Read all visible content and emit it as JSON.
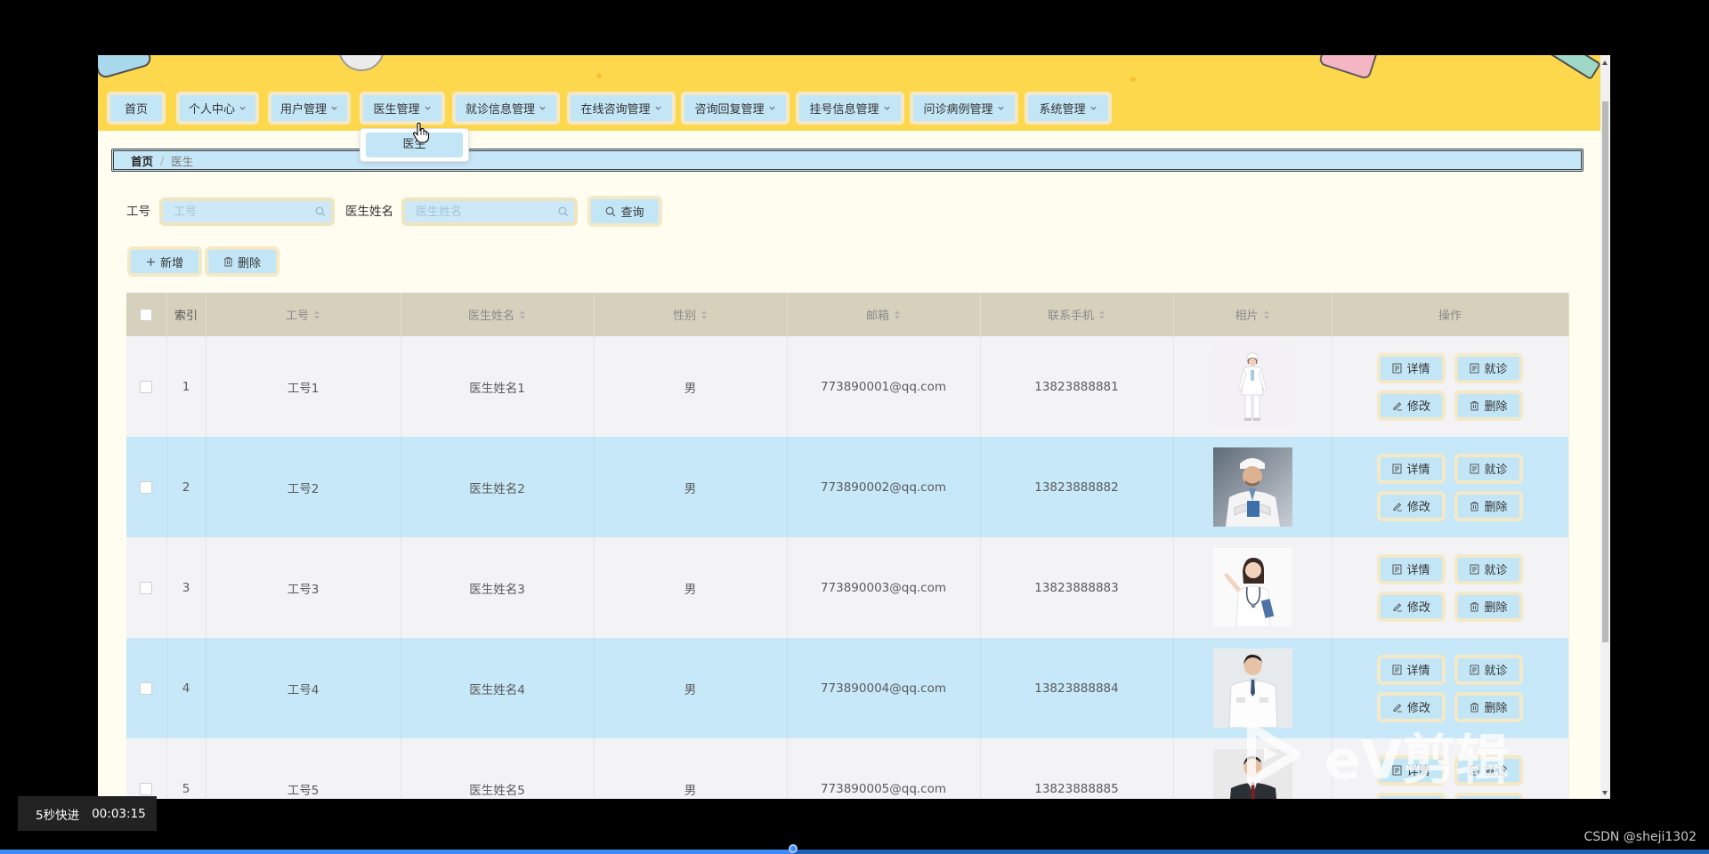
{
  "nav": {
    "items": [
      {
        "label": "首页",
        "has_dropdown": false
      },
      {
        "label": "个人中心",
        "has_dropdown": true
      },
      {
        "label": "用户管理",
        "has_dropdown": true
      },
      {
        "label": "医生管理",
        "has_dropdown": true
      },
      {
        "label": "就诊信息管理",
        "has_dropdown": true
      },
      {
        "label": "在线咨询管理",
        "has_dropdown": true
      },
      {
        "label": "咨询回复管理",
        "has_dropdown": true
      },
      {
        "label": "挂号信息管理",
        "has_dropdown": true
      },
      {
        "label": "问诊病例管理",
        "has_dropdown": true
      },
      {
        "label": "系统管理",
        "has_dropdown": true
      }
    ],
    "dropdown_icon": "chevron-down-icon",
    "dropdown": {
      "items": [
        "医生"
      ]
    }
  },
  "breadcrumb": {
    "home": "首页",
    "separator": "/",
    "current": "医生"
  },
  "search": {
    "id_label": "工号",
    "id_placeholder": "工号",
    "name_label": "医生姓名",
    "name_placeholder": "医生姓名",
    "query_label": "查询",
    "icon": "search-icon"
  },
  "toolbar": {
    "add_label": "新增",
    "add_icon": "plus-icon",
    "delete_label": "删除",
    "delete_icon": "trash-icon"
  },
  "table": {
    "columns": [
      "索引",
      "工号",
      "医生姓名",
      "性别",
      "邮箱",
      "联系手机",
      "相片",
      "操作"
    ],
    "sortable": [
      false,
      true,
      true,
      true,
      true,
      true,
      true,
      false
    ],
    "row_actions": [
      {
        "label": "详情",
        "icon": "document-icon"
      },
      {
        "label": "就诊",
        "icon": "document-icon"
      },
      {
        "label": "修改",
        "icon": "pencil-icon"
      },
      {
        "label": "删除",
        "icon": "trash-icon"
      }
    ],
    "rows": [
      {
        "index": "1",
        "id": "工号1",
        "name": "医生姓名1",
        "gender": "男",
        "email": "773890001@qq.com",
        "phone": "13823888881"
      },
      {
        "index": "2",
        "id": "工号2",
        "name": "医生姓名2",
        "gender": "男",
        "email": "773890002@qq.com",
        "phone": "13823888882"
      },
      {
        "index": "3",
        "id": "工号3",
        "name": "医生姓名3",
        "gender": "男",
        "email": "773890003@qq.com",
        "phone": "13823888883"
      },
      {
        "index": "4",
        "id": "工号4",
        "name": "医生姓名4",
        "gender": "男",
        "email": "773890004@qq.com",
        "phone": "13823888884"
      },
      {
        "index": "5",
        "id": "工号5",
        "name": "医生姓名5",
        "gender": "男",
        "email": "773890005@qq.com",
        "phone": "13823888885"
      }
    ]
  },
  "player": {
    "skip_label": "5秒快进",
    "time": "00:03:15",
    "progress": 0.464
  },
  "credit": "CSDN @sheji1302",
  "watermark": "eV剪辑",
  "colors": {
    "nav_background": "#fed84c",
    "button_fill": "#c3e6f7",
    "button_border": "#f3e9c8",
    "content_background": "#fffdf0",
    "breadcrumb_background": "#c6e7f8",
    "table_header": "#d6d1bc",
    "row": "#f3f3f5",
    "row_alt": "#c7e8f8",
    "progress": "#3b8cf5"
  }
}
